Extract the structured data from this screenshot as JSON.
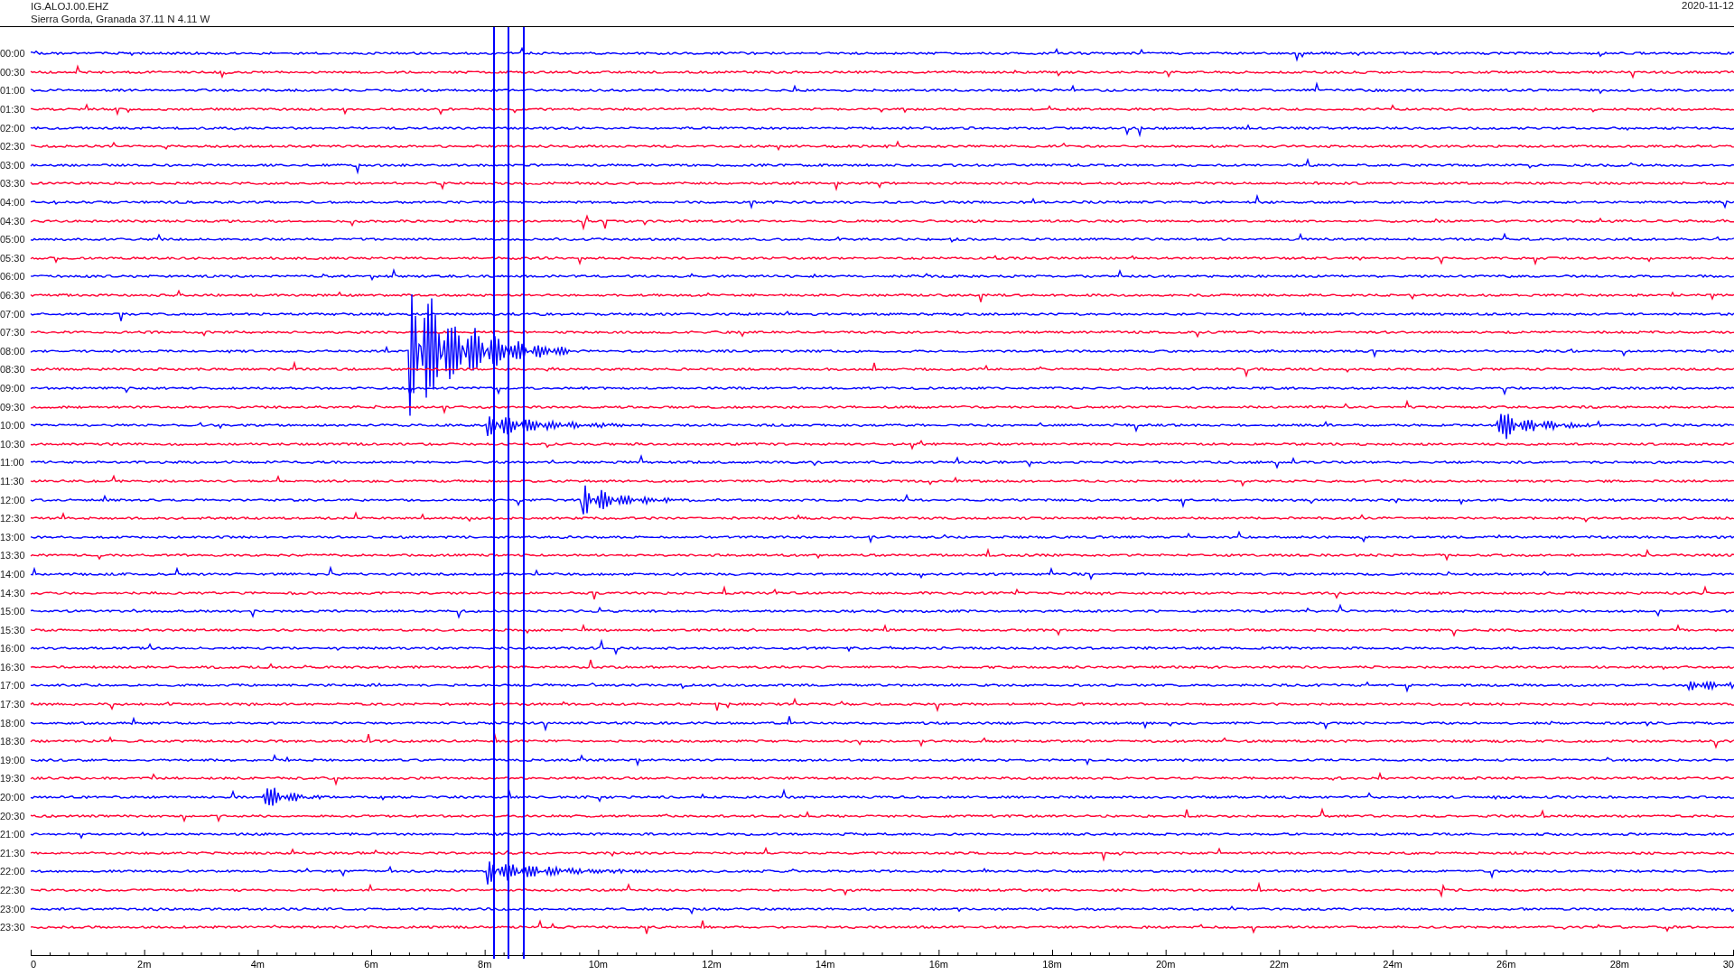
{
  "header": {
    "station": "IG.ALOJ.00.EHZ",
    "location": "Sierra Gorda, Granada  37.11 N 4.11 W",
    "date": "2020-11-12"
  },
  "traces": [
    {
      "label": "00:00",
      "color": "#0000ff"
    },
    {
      "label": "00:30",
      "color": "#ff0033"
    },
    {
      "label": "01:00",
      "color": "#0000ff"
    },
    {
      "label": "01:30",
      "color": "#ff0033"
    },
    {
      "label": "02:00",
      "color": "#0000ff"
    },
    {
      "label": "02:30",
      "color": "#ff0033"
    },
    {
      "label": "03:00",
      "color": "#0000ff"
    },
    {
      "label": "03:30",
      "color": "#ff0033"
    },
    {
      "label": "04:00",
      "color": "#0000ff"
    },
    {
      "label": "04:30",
      "color": "#ff0033"
    },
    {
      "label": "05:00",
      "color": "#0000ff"
    },
    {
      "label": "05:30",
      "color": "#ff0033"
    },
    {
      "label": "06:00",
      "color": "#0000ff"
    },
    {
      "label": "06:30",
      "color": "#ff0033"
    },
    {
      "label": "07:00",
      "color": "#0000ff"
    },
    {
      "label": "07:30",
      "color": "#ff0033"
    },
    {
      "label": "08:00",
      "color": "#0000ff"
    },
    {
      "label": "08:30",
      "color": "#ff0033"
    },
    {
      "label": "09:00",
      "color": "#0000ff"
    },
    {
      "label": "09:30",
      "color": "#ff0033"
    },
    {
      "label": "10:00",
      "color": "#0000ff"
    },
    {
      "label": "10:30",
      "color": "#ff0033"
    },
    {
      "label": "11:00",
      "color": "#0000ff"
    },
    {
      "label": "11:30",
      "color": "#ff0033"
    },
    {
      "label": "12:00",
      "color": "#0000ff"
    },
    {
      "label": "12:30",
      "color": "#ff0033"
    },
    {
      "label": "13:00",
      "color": "#0000ff"
    },
    {
      "label": "13:30",
      "color": "#ff0033"
    },
    {
      "label": "14:00",
      "color": "#0000ff"
    },
    {
      "label": "14:30",
      "color": "#ff0033"
    },
    {
      "label": "15:00",
      "color": "#0000ff"
    },
    {
      "label": "15:30",
      "color": "#ff0033"
    },
    {
      "label": "16:00",
      "color": "#0000ff"
    },
    {
      "label": "16:30",
      "color": "#ff0033"
    },
    {
      "label": "17:00",
      "color": "#0000ff"
    },
    {
      "label": "17:30",
      "color": "#ff0033"
    },
    {
      "label": "18:00",
      "color": "#0000ff"
    },
    {
      "label": "18:30",
      "color": "#ff0033"
    },
    {
      "label": "19:00",
      "color": "#0000ff"
    },
    {
      "label": "19:30",
      "color": "#ff0033"
    },
    {
      "label": "20:00",
      "color": "#0000ff"
    },
    {
      "label": "20:30",
      "color": "#ff0033"
    },
    {
      "label": "21:00",
      "color": "#0000ff"
    },
    {
      "label": "21:30",
      "color": "#ff0033"
    },
    {
      "label": "22:00",
      "color": "#0000ff"
    },
    {
      "label": "22:30",
      "color": "#ff0033"
    },
    {
      "label": "23:00",
      "color": "#0000ff"
    },
    {
      "label": "23:30",
      "color": "#ff0033"
    }
  ],
  "x_axis": {
    "tick_labels": [
      "0",
      "2m",
      "4m",
      "6m",
      "8m",
      "10m",
      "12m",
      "14m",
      "16m",
      "18m",
      "20m",
      "22m",
      "24m",
      "26m",
      "28m",
      "30"
    ]
  }
}
